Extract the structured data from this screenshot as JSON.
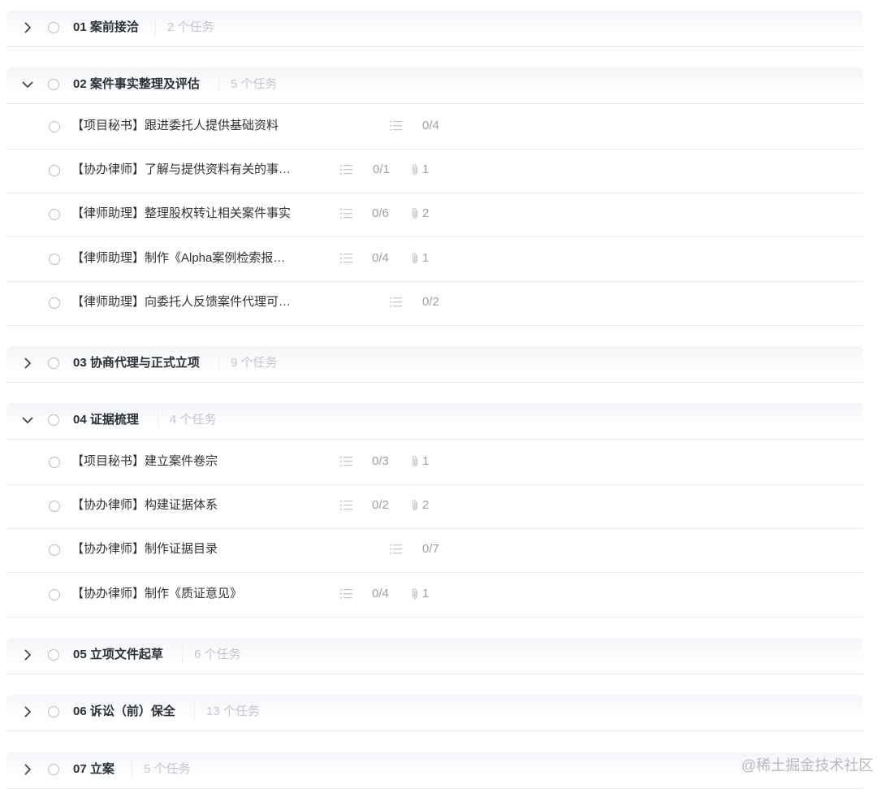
{
  "groups": [
    {
      "title": "01 案前接洽",
      "count": "2 个任务",
      "expanded": false,
      "tasks": []
    },
    {
      "title": "02 案件事实整理及评估",
      "count": "5 个任务",
      "expanded": true,
      "tasks": [
        {
          "title": "【项目秘书】跟进委托人提供基础资料",
          "subtasks": "0/4",
          "attachments": ""
        },
        {
          "title": "【协办律师】了解与提供资料有关的事…",
          "subtasks": "0/1",
          "attachments": "1"
        },
        {
          "title": "【律师助理】整理股权转让相关案件事实",
          "subtasks": "0/6",
          "attachments": "2"
        },
        {
          "title": "【律师助理】制作《Alpha案例检索报…",
          "subtasks": "0/4",
          "attachments": "1"
        },
        {
          "title": "【律师助理】向委托人反馈案件代理可…",
          "subtasks": "0/2",
          "attachments": ""
        }
      ]
    },
    {
      "title": "03 协商代理与正式立项",
      "count": "9 个任务",
      "expanded": false,
      "tasks": []
    },
    {
      "title": "04 证据梳理",
      "count": "4 个任务",
      "expanded": true,
      "tasks": [
        {
          "title": "【项目秘书】建立案件卷宗",
          "subtasks": "0/3",
          "attachments": "1"
        },
        {
          "title": "【协办律师】构建证据体系",
          "subtasks": "0/2",
          "attachments": "2"
        },
        {
          "title": "【协办律师】制作证据目录",
          "subtasks": "0/7",
          "attachments": ""
        },
        {
          "title": "【协办律师】制作《质证意见》",
          "subtasks": "0/4",
          "attachments": "1"
        }
      ]
    },
    {
      "title": "05 立项文件起草",
      "count": "6 个任务",
      "expanded": false,
      "tasks": []
    },
    {
      "title": "06 诉讼（前）保全",
      "count": "13 个任务",
      "expanded": false,
      "tasks": []
    },
    {
      "title": "07 立案",
      "count": "5 个任务",
      "expanded": false,
      "tasks": []
    }
  ],
  "icons": {
    "expand": "chevron-right-icon",
    "collapse": "chevron-down-icon",
    "complete": "circle-checkbox-icon",
    "subtasks": "list-icon",
    "attachments": "paperclip-icon"
  },
  "watermark": "@稀土掘金技术社区",
  "colors": {
    "group_title": "#2b2f36",
    "muted": "#9da1a7",
    "count": "#c3c6cc",
    "divider": "#e4e6ea",
    "header_bg": "#f3f5f8"
  }
}
